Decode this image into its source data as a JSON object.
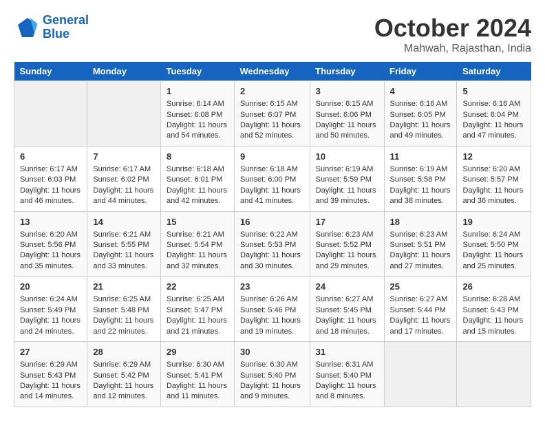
{
  "logo": {
    "line1": "General",
    "line2": "Blue"
  },
  "title": "October 2024",
  "location": "Mahwah, Rajasthan, India",
  "headers": [
    "Sunday",
    "Monday",
    "Tuesday",
    "Wednesday",
    "Thursday",
    "Friday",
    "Saturday"
  ],
  "weeks": [
    [
      {
        "day": "",
        "empty": true
      },
      {
        "day": "",
        "empty": true
      },
      {
        "day": "1",
        "sunrise": "6:14 AM",
        "sunset": "6:08 PM",
        "daylight": "11 hours and 54 minutes."
      },
      {
        "day": "2",
        "sunrise": "6:15 AM",
        "sunset": "6:07 PM",
        "daylight": "11 hours and 52 minutes."
      },
      {
        "day": "3",
        "sunrise": "6:15 AM",
        "sunset": "6:06 PM",
        "daylight": "11 hours and 50 minutes."
      },
      {
        "day": "4",
        "sunrise": "6:16 AM",
        "sunset": "6:05 PM",
        "daylight": "11 hours and 49 minutes."
      },
      {
        "day": "5",
        "sunrise": "6:16 AM",
        "sunset": "6:04 PM",
        "daylight": "11 hours and 47 minutes."
      }
    ],
    [
      {
        "day": "6",
        "sunrise": "6:17 AM",
        "sunset": "6:03 PM",
        "daylight": "11 hours and 46 minutes."
      },
      {
        "day": "7",
        "sunrise": "6:17 AM",
        "sunset": "6:02 PM",
        "daylight": "11 hours and 44 minutes."
      },
      {
        "day": "8",
        "sunrise": "6:18 AM",
        "sunset": "6:01 PM",
        "daylight": "11 hours and 42 minutes."
      },
      {
        "day": "9",
        "sunrise": "6:18 AM",
        "sunset": "6:00 PM",
        "daylight": "11 hours and 41 minutes."
      },
      {
        "day": "10",
        "sunrise": "6:19 AM",
        "sunset": "5:59 PM",
        "daylight": "11 hours and 39 minutes."
      },
      {
        "day": "11",
        "sunrise": "6:19 AM",
        "sunset": "5:58 PM",
        "daylight": "11 hours and 38 minutes."
      },
      {
        "day": "12",
        "sunrise": "6:20 AM",
        "sunset": "5:57 PM",
        "daylight": "11 hours and 36 minutes."
      }
    ],
    [
      {
        "day": "13",
        "sunrise": "6:20 AM",
        "sunset": "5:56 PM",
        "daylight": "11 hours and 35 minutes."
      },
      {
        "day": "14",
        "sunrise": "6:21 AM",
        "sunset": "5:55 PM",
        "daylight": "11 hours and 33 minutes."
      },
      {
        "day": "15",
        "sunrise": "6:21 AM",
        "sunset": "5:54 PM",
        "daylight": "11 hours and 32 minutes."
      },
      {
        "day": "16",
        "sunrise": "6:22 AM",
        "sunset": "5:53 PM",
        "daylight": "11 hours and 30 minutes."
      },
      {
        "day": "17",
        "sunrise": "6:23 AM",
        "sunset": "5:52 PM",
        "daylight": "11 hours and 29 minutes."
      },
      {
        "day": "18",
        "sunrise": "6:23 AM",
        "sunset": "5:51 PM",
        "daylight": "11 hours and 27 minutes."
      },
      {
        "day": "19",
        "sunrise": "6:24 AM",
        "sunset": "5:50 PM",
        "daylight": "11 hours and 25 minutes."
      }
    ],
    [
      {
        "day": "20",
        "sunrise": "6:24 AM",
        "sunset": "5:49 PM",
        "daylight": "11 hours and 24 minutes."
      },
      {
        "day": "21",
        "sunrise": "6:25 AM",
        "sunset": "5:48 PM",
        "daylight": "11 hours and 22 minutes."
      },
      {
        "day": "22",
        "sunrise": "6:25 AM",
        "sunset": "5:47 PM",
        "daylight": "11 hours and 21 minutes."
      },
      {
        "day": "23",
        "sunrise": "6:26 AM",
        "sunset": "5:46 PM",
        "daylight": "11 hours and 19 minutes."
      },
      {
        "day": "24",
        "sunrise": "6:27 AM",
        "sunset": "5:45 PM",
        "daylight": "11 hours and 18 minutes."
      },
      {
        "day": "25",
        "sunrise": "6:27 AM",
        "sunset": "5:44 PM",
        "daylight": "11 hours and 17 minutes."
      },
      {
        "day": "26",
        "sunrise": "6:28 AM",
        "sunset": "5:43 PM",
        "daylight": "11 hours and 15 minutes."
      }
    ],
    [
      {
        "day": "27",
        "sunrise": "6:29 AM",
        "sunset": "5:43 PM",
        "daylight": "11 hours and 14 minutes."
      },
      {
        "day": "28",
        "sunrise": "6:29 AM",
        "sunset": "5:42 PM",
        "daylight": "11 hours and 12 minutes."
      },
      {
        "day": "29",
        "sunrise": "6:30 AM",
        "sunset": "5:41 PM",
        "daylight": "11 hours and 11 minutes."
      },
      {
        "day": "30",
        "sunrise": "6:30 AM",
        "sunset": "5:40 PM",
        "daylight": "11 hours and 9 minutes."
      },
      {
        "day": "31",
        "sunrise": "6:31 AM",
        "sunset": "5:40 PM",
        "daylight": "11 hours and 8 minutes."
      },
      {
        "day": "",
        "empty": true
      },
      {
        "day": "",
        "empty": true
      }
    ]
  ],
  "labels": {
    "sunrise": "Sunrise:",
    "sunset": "Sunset:",
    "daylight": "Daylight:"
  }
}
